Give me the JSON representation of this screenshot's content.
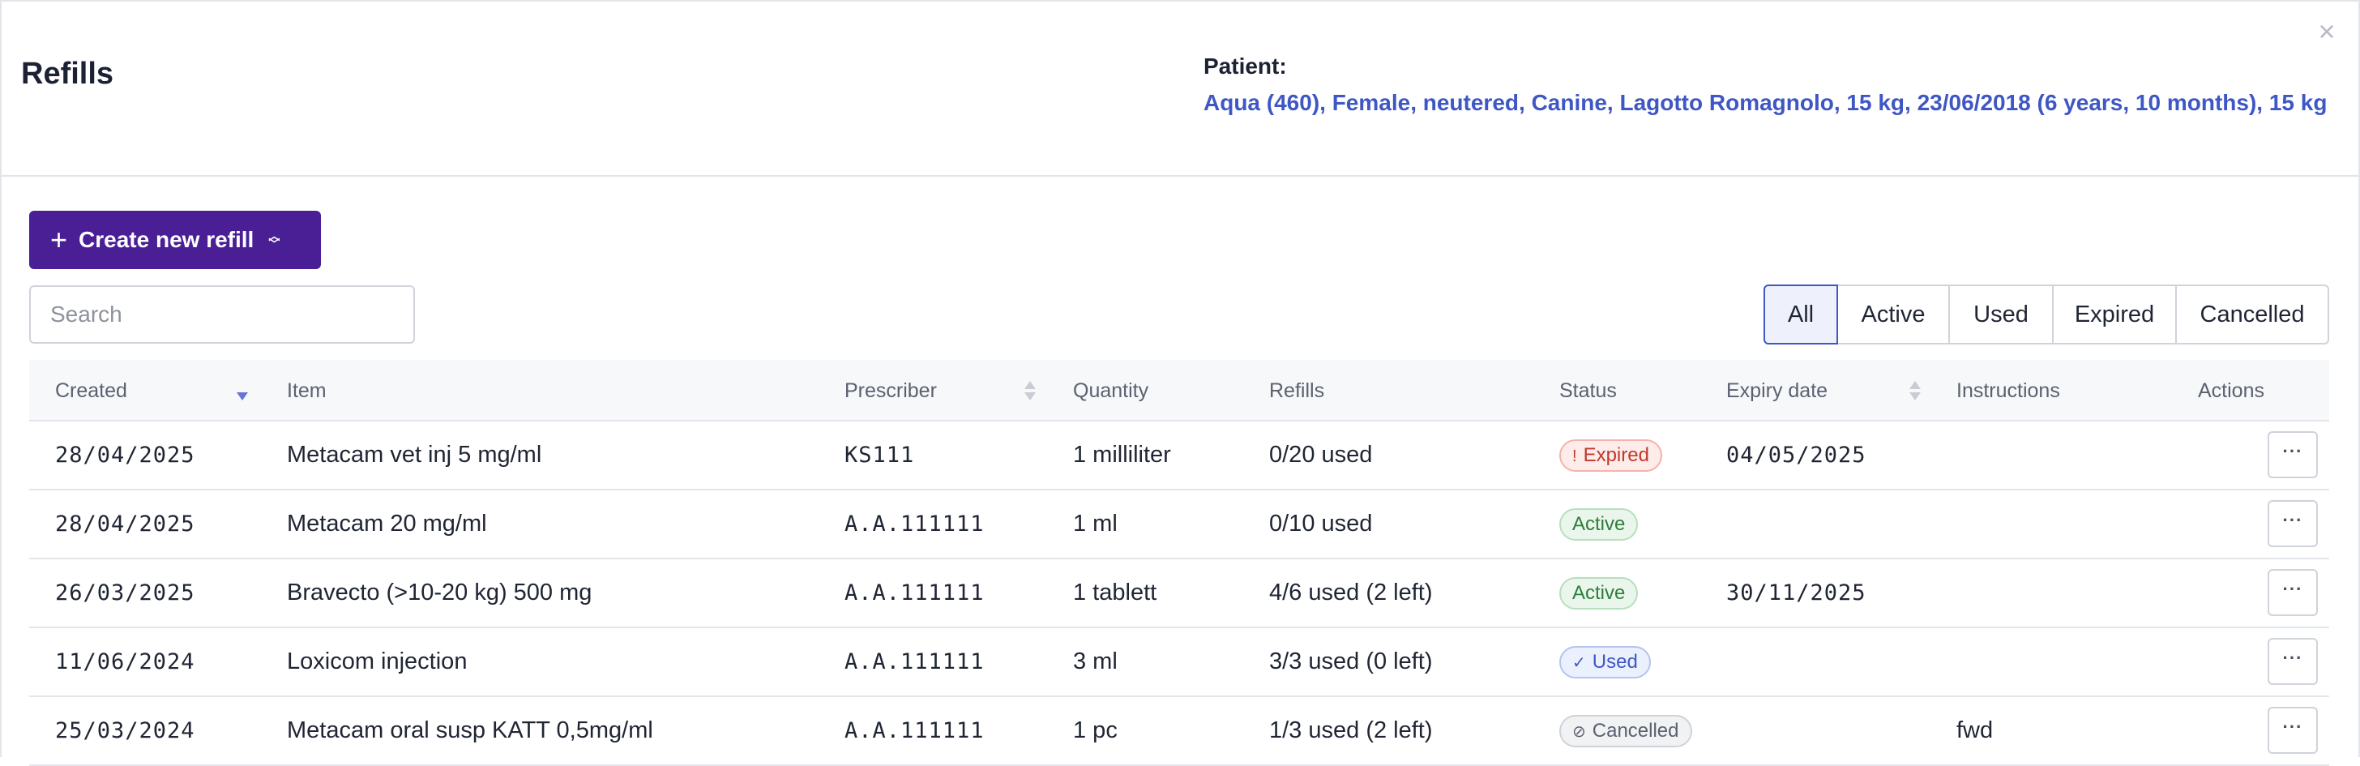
{
  "header": {
    "title": "Refills",
    "close_icon": "×",
    "patient_label": "Patient:",
    "patient_info": "Aqua (460), Female, neutered, Canine, Lagotto Romagnolo, 15 kg, 23/06/2018 (6 years, 10 months), 15 kg"
  },
  "toolbar": {
    "create_label": "Create new refill",
    "search_placeholder": "Search",
    "filters": [
      "All",
      "Active",
      "Used",
      "Expired",
      "Cancelled"
    ],
    "active_filter": "All"
  },
  "table": {
    "columns": {
      "created": "Created",
      "item": "Item",
      "prescriber": "Prescriber",
      "quantity": "Quantity",
      "refills": "Refills",
      "status": "Status",
      "expiry": "Expiry date",
      "instructions": "Instructions",
      "actions": "Actions"
    },
    "rows": [
      {
        "created": "28/04/2025",
        "item": "Metacam vet inj 5 mg/ml",
        "prescriber": "KS111",
        "quantity": "1 milliliter",
        "refills": "0/20 used",
        "status": "Expired",
        "status_icon": "!",
        "expiry": "04/05/2025",
        "instructions": "",
        "actions": "···"
      },
      {
        "created": "28/04/2025",
        "item": "Metacam 20 mg/ml",
        "prescriber": "A.A.111111",
        "quantity": "1 ml",
        "refills": "0/10 used",
        "status": "Active",
        "status_icon": "",
        "expiry": "",
        "instructions": "",
        "actions": "···"
      },
      {
        "created": "26/03/2025",
        "item": "Bravecto (>10-20 kg) 500 mg",
        "prescriber": "A.A.111111",
        "quantity": "1 tablett",
        "refills": "4/6 used (2 left)",
        "status": "Active",
        "status_icon": "",
        "expiry": "30/11/2025",
        "instructions": "",
        "actions": "···"
      },
      {
        "created": "11/06/2024",
        "item": "Loxicom injection",
        "prescriber": "A.A.111111",
        "quantity": "3 ml",
        "refills": "3/3 used (0 left)",
        "status": "Used",
        "status_icon": "✓",
        "expiry": "",
        "instructions": "",
        "actions": "···"
      },
      {
        "created": "25/03/2024",
        "item": "Metacam oral susp KATT 0,5mg/ml",
        "prescriber": "A.A.111111",
        "quantity": "1 pc",
        "refills": "1/3 used (2 left)",
        "status": "Cancelled",
        "status_icon": "⊘",
        "expiry": "",
        "instructions": "fwd",
        "actions": "···"
      }
    ]
  }
}
